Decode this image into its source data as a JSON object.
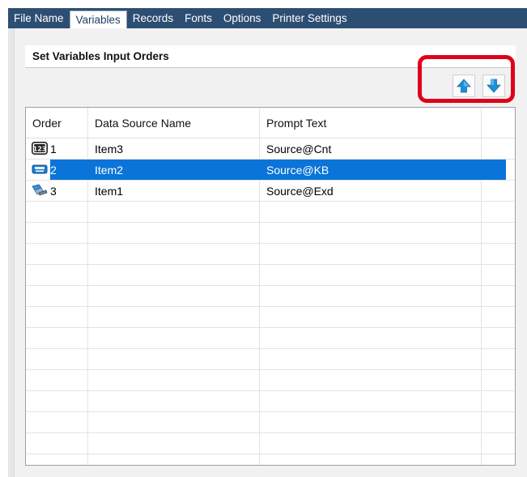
{
  "tabs": [
    {
      "label": "File Name",
      "active": false
    },
    {
      "label": "Variables",
      "active": true
    },
    {
      "label": "Records",
      "active": false
    },
    {
      "label": "Fonts",
      "active": false
    },
    {
      "label": "Options",
      "active": false
    },
    {
      "label": "Printer Settings",
      "active": false
    }
  ],
  "group": {
    "title": "Set Variables Input Orders"
  },
  "buttons": {
    "move_up_icon": "up-arrow-icon",
    "move_down_icon": "down-arrow-icon"
  },
  "table": {
    "headers": {
      "order": "Order",
      "source": "Data Source Name",
      "prompt": "Prompt Text"
    },
    "rows": [
      {
        "order": "1",
        "source": "Item3",
        "prompt": "Source@Cnt",
        "icon": "counter-icon",
        "selected": false
      },
      {
        "order": "2",
        "source": "Item2",
        "prompt": "Source@KB",
        "icon": "keyboard-icon",
        "selected": true
      },
      {
        "order": "3",
        "source": "Item1",
        "prompt": "Source@Exd",
        "icon": "database-link-icon",
        "selected": false
      }
    ],
    "empty_rows": 12
  },
  "colors": {
    "tab_bar": "#2d4e73",
    "selection": "#0a74d8",
    "highlight": "#e0001a",
    "arrow_fill": "#1d8fd6"
  }
}
